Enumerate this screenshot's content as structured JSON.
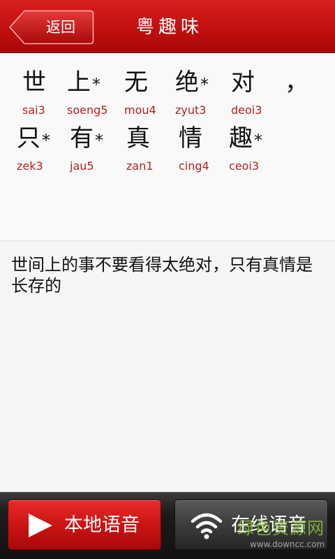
{
  "header": {
    "back_label": "返回",
    "title": "粤趣味"
  },
  "phrase": {
    "row1": [
      {
        "char": "世",
        "jyutping": "sai3",
        "starred": false
      },
      {
        "char": "上",
        "jyutping": "soeng5",
        "starred": true
      },
      {
        "char": "无",
        "jyutping": "mou4",
        "starred": false
      },
      {
        "char": "绝",
        "jyutping": "zyut3",
        "starred": true
      },
      {
        "char": "对",
        "jyutping": "deoi3",
        "starred": false
      },
      {
        "char": "，",
        "jyutping": "",
        "starred": false
      }
    ],
    "row2": [
      {
        "char": "只",
        "jyutping": "zek3",
        "starred": true
      },
      {
        "char": "有",
        "jyutping": "jau5",
        "starred": true
      },
      {
        "char": "真",
        "jyutping": "zan1",
        "starred": false
      },
      {
        "char": "情",
        "jyutping": "cing4",
        "starred": false
      },
      {
        "char": "趣",
        "jyutping": "ceoi3",
        "starred": true
      }
    ],
    "star_symbol": "*"
  },
  "meaning": {
    "text": "世间上的事不要看得太绝对，只有真情是长存的"
  },
  "bottom": {
    "local_label": "本地语音",
    "online_label": "在线语音"
  },
  "watermark": {
    "cn": "绿色资源网",
    "url": "www.downcc.com"
  },
  "colors": {
    "header_red": "#c20f0f",
    "jyutping_red": "#b32020",
    "local_button_red": "#cc1414",
    "online_button_gray": "#3c3c3c"
  }
}
